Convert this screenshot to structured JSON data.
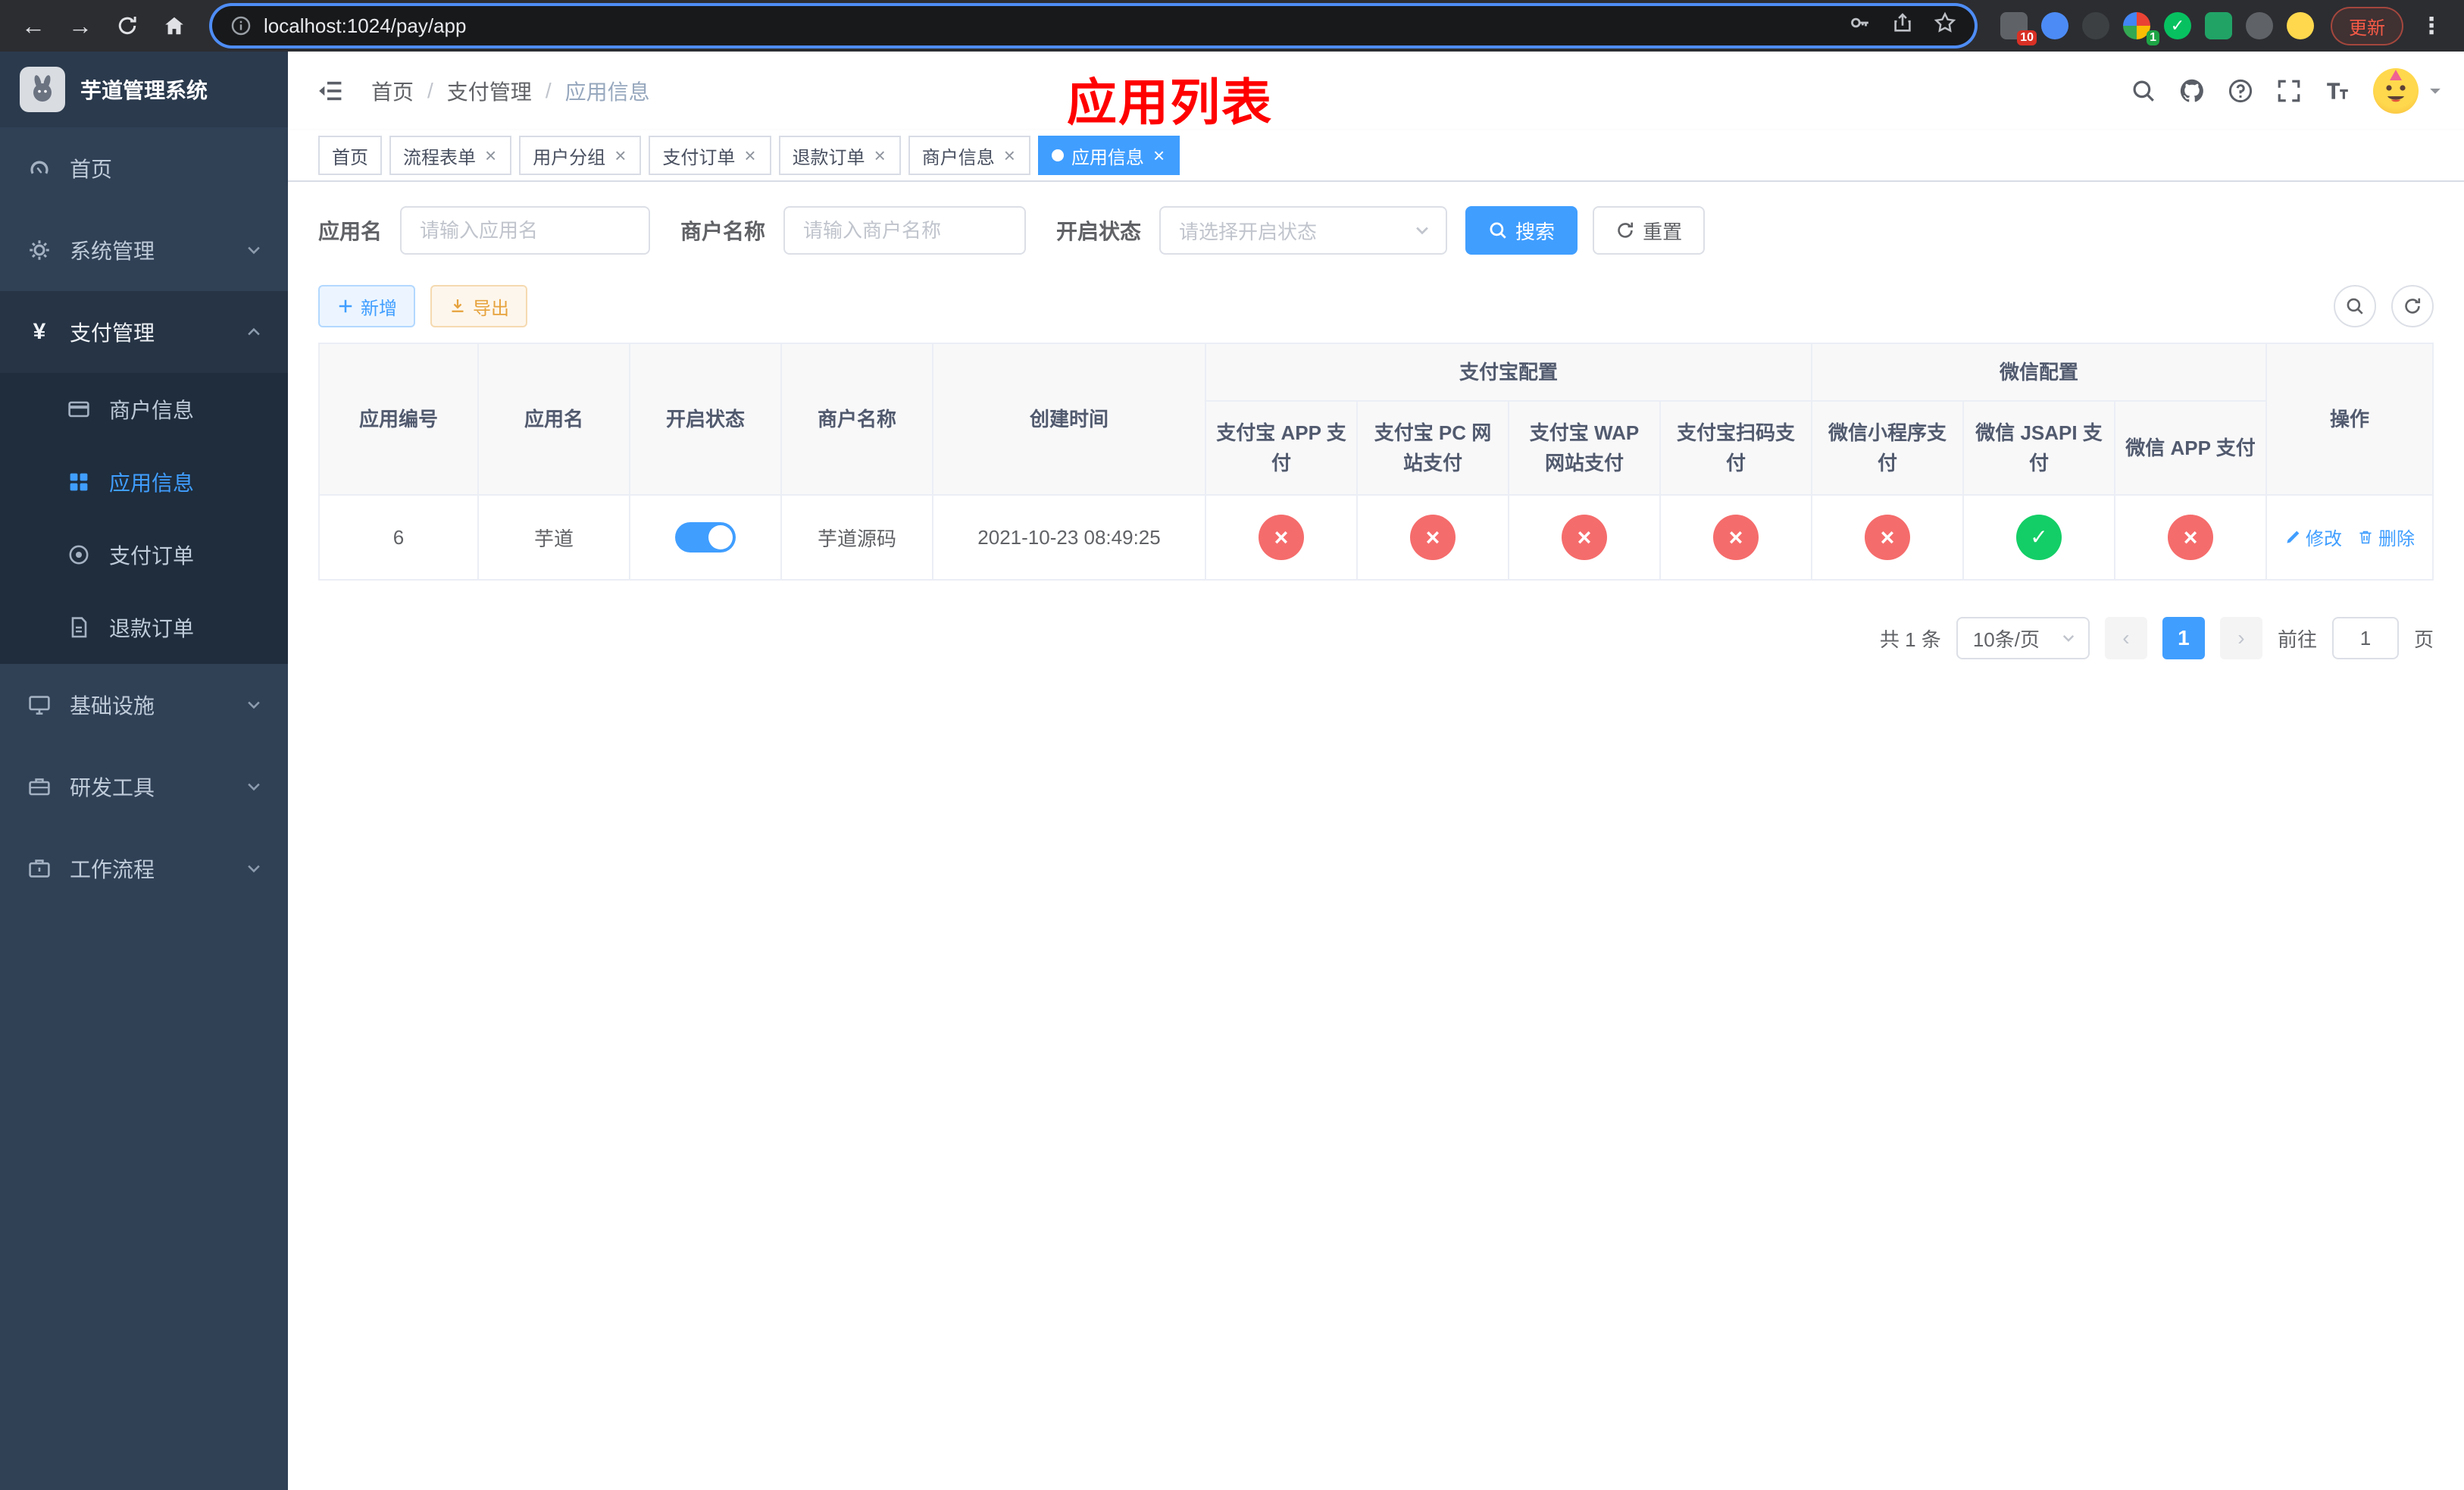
{
  "browser": {
    "url": "localhost:1024/pay/app",
    "update_button": "更新",
    "badges": {
      "extensions": "10",
      "profile": "1"
    }
  },
  "sidebar": {
    "logo_title": "芋道管理系统",
    "items": {
      "home": "首页",
      "system": "系统管理",
      "payment": "支付管理",
      "infra": "基础设施",
      "devtools": "研发工具",
      "workflow": "工作流程"
    },
    "payment_children": {
      "merchant": "商户信息",
      "app": "应用信息",
      "order": "支付订单",
      "refund": "退款订单"
    }
  },
  "header": {
    "breadcrumb": {
      "home": "首页",
      "section": "支付管理",
      "current": "应用信息"
    },
    "page_title": "应用列表"
  },
  "tabs": [
    {
      "label": "首页",
      "closable": false
    },
    {
      "label": "流程表单",
      "closable": true
    },
    {
      "label": "用户分组",
      "closable": true
    },
    {
      "label": "支付订单",
      "closable": true
    },
    {
      "label": "退款订单",
      "closable": true
    },
    {
      "label": "商户信息",
      "closable": true
    },
    {
      "label": "应用信息",
      "closable": true,
      "active": true
    }
  ],
  "filters": {
    "app_name": {
      "label": "应用名",
      "placeholder": "请输入应用名"
    },
    "merchant": {
      "label": "商户名称",
      "placeholder": "请输入商户名称"
    },
    "status": {
      "label": "开启状态",
      "placeholder": "请选择开启状态"
    },
    "search": "搜索",
    "reset": "重置"
  },
  "toolbar": {
    "add": "新增",
    "export": "导出"
  },
  "table": {
    "groups": {
      "alipay": "支付宝配置",
      "wechat": "微信配置"
    },
    "columns": {
      "id": "应用编号",
      "name": "应用名",
      "status": "开启状态",
      "merchant": "商户名称",
      "created": "创建时间",
      "alipay_app": "支付宝 APP 支付",
      "alipay_pc": "支付宝 PC 网站支付",
      "alipay_wap": "支付宝 WAP 网站支付",
      "alipay_qr": "支付宝扫码支付",
      "wx_lite": "微信小程序支付",
      "wx_jsapi": "微信 JSAPI 支付",
      "wx_app": "微信 APP 支付",
      "actions": "操作"
    },
    "rows": [
      {
        "id": "6",
        "name": "芋道",
        "status_on": true,
        "merchant": "芋道源码",
        "created": "2021-10-23 08:49:25",
        "configs": [
          "no",
          "no",
          "no",
          "no",
          "no",
          "yes",
          "no"
        ],
        "edit_label": "修改",
        "delete_label": "删除"
      }
    ]
  },
  "pagination": {
    "total": "共 1 条",
    "page_size": "10条/页",
    "page": "1",
    "goto_prefix": "前往",
    "goto_value": "1",
    "goto_suffix": "页"
  }
}
